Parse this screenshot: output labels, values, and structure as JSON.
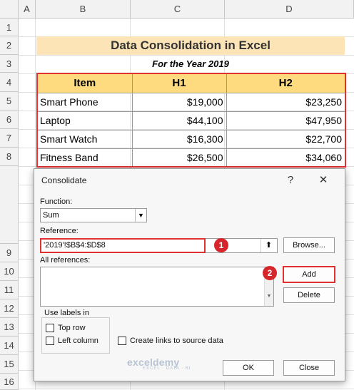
{
  "columns": [
    "A",
    "B",
    "C",
    "D"
  ],
  "rows": [
    "1",
    "2",
    "3",
    "4",
    "5",
    "6",
    "7",
    "8",
    "9",
    "10",
    "11",
    "12",
    "13",
    "14",
    "15",
    "16"
  ],
  "sheet": {
    "title": "Data Consolidation in Excel",
    "subtitle": "For the Year 2019",
    "headers": [
      "Item",
      "H1",
      "H2"
    ],
    "table": [
      [
        "Smart Phone",
        "$19,000",
        "$23,250"
      ],
      [
        "Laptop",
        "$44,100",
        "$47,950"
      ],
      [
        "Smart Watch",
        "$16,300",
        "$22,700"
      ],
      [
        "Fitness Band",
        "$26,500",
        "$34,060"
      ]
    ]
  },
  "dialog": {
    "title": "Consolidate",
    "help": "?",
    "close": "✕",
    "function_label": "Function:",
    "function_value": "Sum",
    "reference_label": "Reference:",
    "reference_value": "'2019'!$B$4:$D$8",
    "browse_label": "Browse...",
    "all_references_label": "All references:",
    "add_label": "Add",
    "delete_label": "Delete",
    "use_labels_label": "Use labels in",
    "top_row_label": "Top row",
    "left_column_label": "Left column",
    "create_links_label": "Create links to source data",
    "ok_label": "OK",
    "close_label": "Close"
  },
  "callouts": [
    "1",
    "2"
  ],
  "watermark": {
    "name": "exceldemy",
    "tagline": "EXCEL · DATA · BI"
  },
  "colors": {
    "title_fill": "#fce4b6",
    "header_fill": "#fddb7e",
    "highlight": "#e03030",
    "badge": "#d7252c"
  }
}
